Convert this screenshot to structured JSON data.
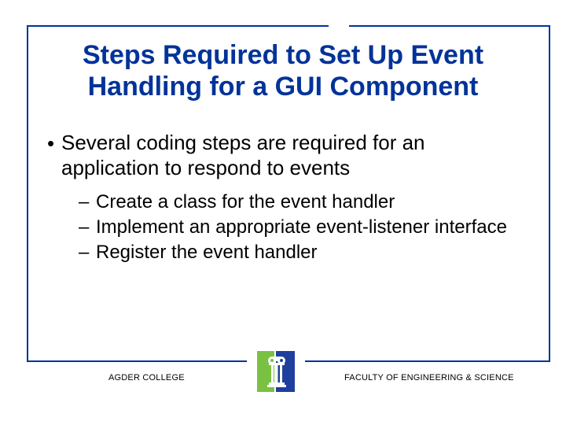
{
  "title": "Steps Required to Set Up Event Handling for a GUI Component",
  "body": {
    "bullet1": "Several coding steps are required for an application to respond to events",
    "subbullets": {
      "s1": "Create a class for the event handler",
      "s2": "Implement an appropriate event-listener interface",
      "s3": "Register the event handler"
    }
  },
  "footer": {
    "left": "AGDER COLLEGE",
    "right": "FACULTY OF ENGINEERING & SCIENCE"
  },
  "colors": {
    "accent": "#003399",
    "logo_green": "#7AC142",
    "logo_blue": "#1F3F9E",
    "logo_white": "#FFFFFF"
  }
}
